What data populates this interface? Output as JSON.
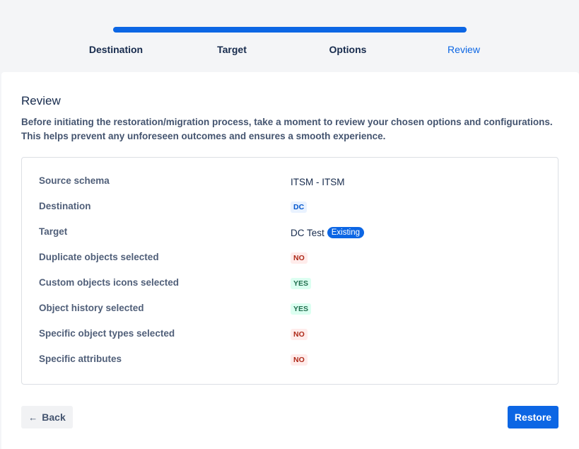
{
  "stepper": {
    "progress_fraction": 1.0,
    "progress_color": "#0c66e4",
    "steps": [
      {
        "label": "Destination"
      },
      {
        "label": "Target"
      },
      {
        "label": "Options"
      },
      {
        "label": "Review"
      }
    ],
    "active_step": "Review"
  },
  "page": {
    "title": "Review",
    "description_line1": "Before initiating the restoration/migration process, take a moment to review your chosen options and configurations.",
    "description_line2": "This helps prevent any unforeseen outcomes and ensures a smooth experience."
  },
  "summary": {
    "rows": [
      {
        "label": "Source schema",
        "value": "ITSM - ITSM"
      },
      {
        "label": "Destination",
        "value": "DC"
      },
      {
        "label": "Target",
        "value": "DC Test",
        "badge": "Existing"
      },
      {
        "label": "Duplicate objects selected",
        "value": "NO"
      },
      {
        "label": "Custom objects icons selected",
        "value": "YES"
      },
      {
        "label": "Object history selected",
        "value": "YES"
      },
      {
        "label": "Specific object types selected",
        "value": "NO"
      },
      {
        "label": "Specific attributes",
        "value": "NO"
      }
    ]
  },
  "actions": {
    "back_label": "Back",
    "back_icon": "arrow-left-icon",
    "restore_label": "Restore"
  }
}
